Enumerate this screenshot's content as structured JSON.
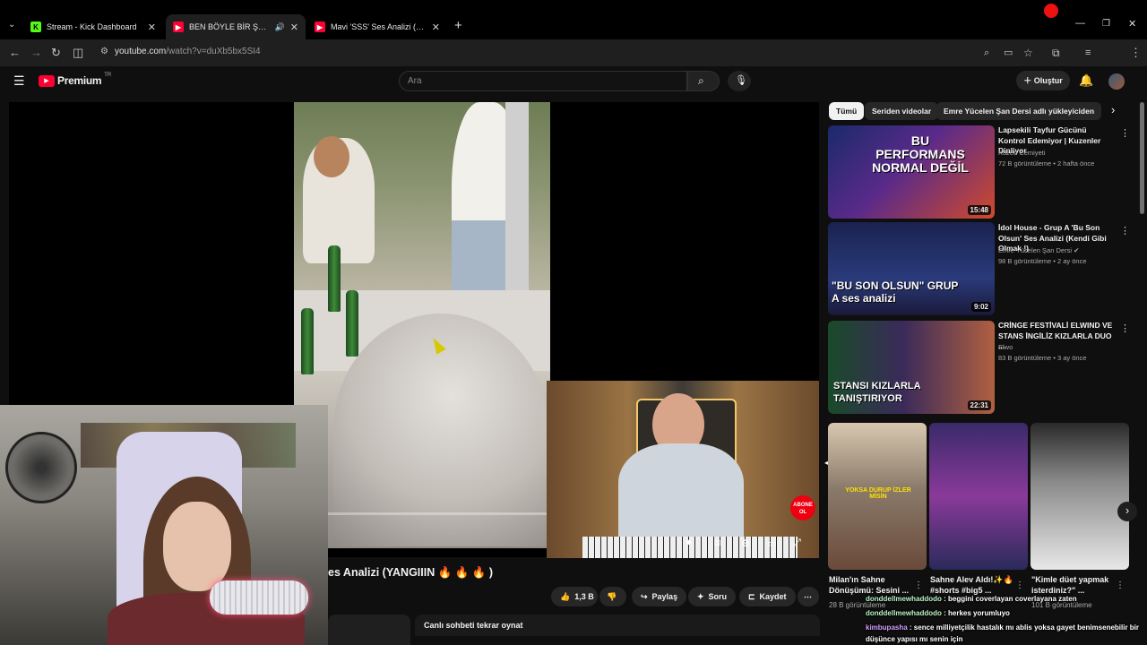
{
  "browser": {
    "tabs": [
      {
        "title": "Stream - Kick Dashboard",
        "icon": "kick-icon",
        "active": false
      },
      {
        "title": "BEN BÖYLE BİR ŞEY DİNLEMEDİM",
        "icon": "youtube-icon",
        "active": true
      },
      {
        "title": "Mavi 'SSS' Ses Analizi (YA ÖZGÜR",
        "icon": "youtube-icon",
        "active": false
      }
    ],
    "new_tab_label": "+",
    "url_host": "youtube.com",
    "url_path": "/watch?v=duXb5bx5SI4"
  },
  "youtube": {
    "logo_text": "Premium",
    "logo_region": "TR",
    "search_placeholder": "Ara",
    "create_label": "Oluştur"
  },
  "video": {
    "title": "es Analizi (YANGIIIN 🔥 🔥 🔥 )",
    "like_count": "1,3 B",
    "share_label": "Paylaş",
    "ask_label": "Soru",
    "save_label": "Kaydet",
    "chat_replay_label": "Canlı sohbeti tekrar oynat",
    "subscribe_badge_top": "ABONE",
    "subscribe_badge_bottom": "OL"
  },
  "chips": [
    "Tümü",
    "Seriden videolar",
    "Emre Yücelen Şan Dersi adlı yükleyiciden"
  ],
  "recommendations": [
    {
      "title": "Lapsekili Tayfur Gücünü Kontrol Edemiyor | Kuzenler Dinliyor",
      "channel": "Kuzen Cemiyeti",
      "meta": "72 B görüntüleme • 2 hafta önce",
      "duration": "15:48",
      "thumb_text": "BU PERFORMANS NORMAL DEĞİL"
    },
    {
      "title": "İdol House - Grup A 'Bu Son Olsun' Ses Analizi (Kendi Gibi Olmak !)",
      "channel": "Emre Yücelen Şan Dersi",
      "meta": "98 B görüntüleme • 2 ay önce",
      "duration": "9:02",
      "thumb_text": "\"BU SON OLSUN\" GRUP A ses analizi"
    },
    {
      "title": "CRİNGE FESTİVALİ ELWIND VE STANS İNGİLİZ KIZLARLA DUO ...",
      "channel": "Elwo",
      "meta": "83 B görüntüleme • 3 ay önce",
      "duration": "22:31",
      "thumb_text": "STANSI KIZLARLA TANIŞTIRIYOR"
    }
  ],
  "shorts": [
    {
      "title": "Milan'ın Sahne Dönüşümü: Sesini ...",
      "meta": "28 B görüntüleme",
      "thumb_text": "YOKSA DURUP İZLER MİSİN"
    },
    {
      "title": "Sahne Alev Aldı!✨🔥 #shorts #big5 ...",
      "meta": ""
    },
    {
      "title": "\"Kimle düet yapmak isterdiniz?\" ...",
      "meta": "101 B görüntüleme"
    }
  ],
  "chat": [
    {
      "user": "donddellmewhaddodo",
      "message": "beggini coverlayan coverlayana zaten"
    },
    {
      "user": "donddellmewhaddodo",
      "message": "herkes yorumluyo"
    },
    {
      "user": "kimbupasha",
      "message": "sence milliyetçilik hastalık mı ablis yoksa gayet benimsenebilir bir"
    },
    {
      "user": "",
      "message": "düşünce yapısı mı senin için"
    }
  ],
  "colors": {
    "accent_red": "#ff0033",
    "chat_green": "#b9f3c7",
    "chat_purple": "#d4a0ff",
    "kick_green": "#53fc18"
  }
}
